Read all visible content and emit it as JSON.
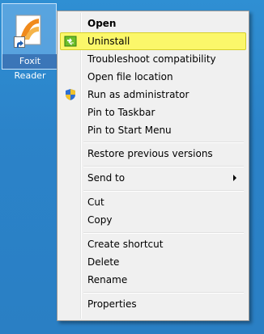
{
  "desktop": {
    "icon_label": "Foxit Reader"
  },
  "menu": {
    "items": [
      {
        "label": "Open"
      },
      {
        "label": "Uninstall"
      },
      {
        "label": "Troubleshoot compatibility"
      },
      {
        "label": "Open file location"
      },
      {
        "label": "Run as administrator"
      },
      {
        "label": "Pin to Taskbar"
      },
      {
        "label": "Pin to Start Menu"
      },
      {
        "label": "Restore previous versions"
      },
      {
        "label": "Send to"
      },
      {
        "label": "Cut"
      },
      {
        "label": "Copy"
      },
      {
        "label": "Create shortcut"
      },
      {
        "label": "Delete"
      },
      {
        "label": "Rename"
      },
      {
        "label": "Properties"
      }
    ],
    "highlight_color": "#fbf76a"
  },
  "icons": {
    "app": "foxit-reader-icon",
    "uninstall": "uninstall-icon",
    "run_as_admin": "uac-shield-icon",
    "send_to": "chevron-right-icon"
  }
}
